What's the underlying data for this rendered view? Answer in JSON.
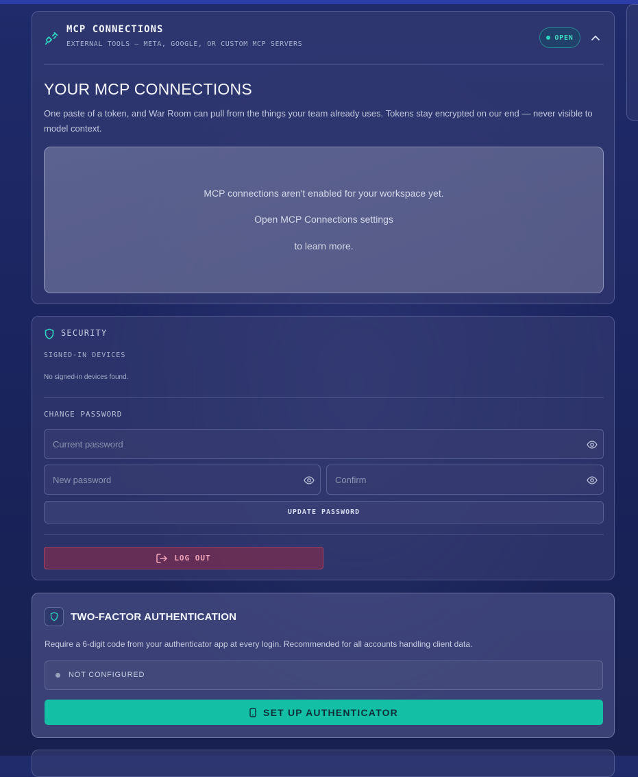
{
  "mcp": {
    "title": "MCP CONNECTIONS",
    "subtitle": "EXTERNAL TOOLS — META, GOOGLE, OR CUSTOM MCP SERVERS",
    "status_badge": "OPEN",
    "heading": "YOUR MCP CONNECTIONS",
    "description": "One paste of a token, and War Room can pull from the things your team already uses. Tokens stay encrypted on our end — never visible to model context.",
    "empty_line1": "MCP connections aren't enabled for your workspace yet.",
    "empty_line2": "Open MCP Connections settings",
    "empty_line3": "to learn more.",
    "icon": "plug-icon"
  },
  "security": {
    "title": "SECURITY",
    "devices_label": "SIGNED-IN DEVICES",
    "devices_empty": "No signed-in devices found.",
    "change_password_label": "CHANGE PASSWORD",
    "current_password_placeholder": "Current password",
    "new_password_placeholder": "New password",
    "confirm_placeholder": "Confirm",
    "update_button": "UPDATE PASSWORD",
    "logout_button": "LOG OUT",
    "icon": "shield-icon"
  },
  "two_factor": {
    "title": "TWO-FACTOR AUTHENTICATION",
    "description": "Require a 6-digit code from your authenticator app at every login. Recommended for all accounts handling client data.",
    "status": "NOT CONFIGURED",
    "setup_button": "SET UP AUTHENTICATOR",
    "icon": "shield-icon"
  },
  "colors": {
    "accent": "#2dd4bf",
    "danger": "#f3a7bb",
    "primary_button": "#13c0a6"
  }
}
